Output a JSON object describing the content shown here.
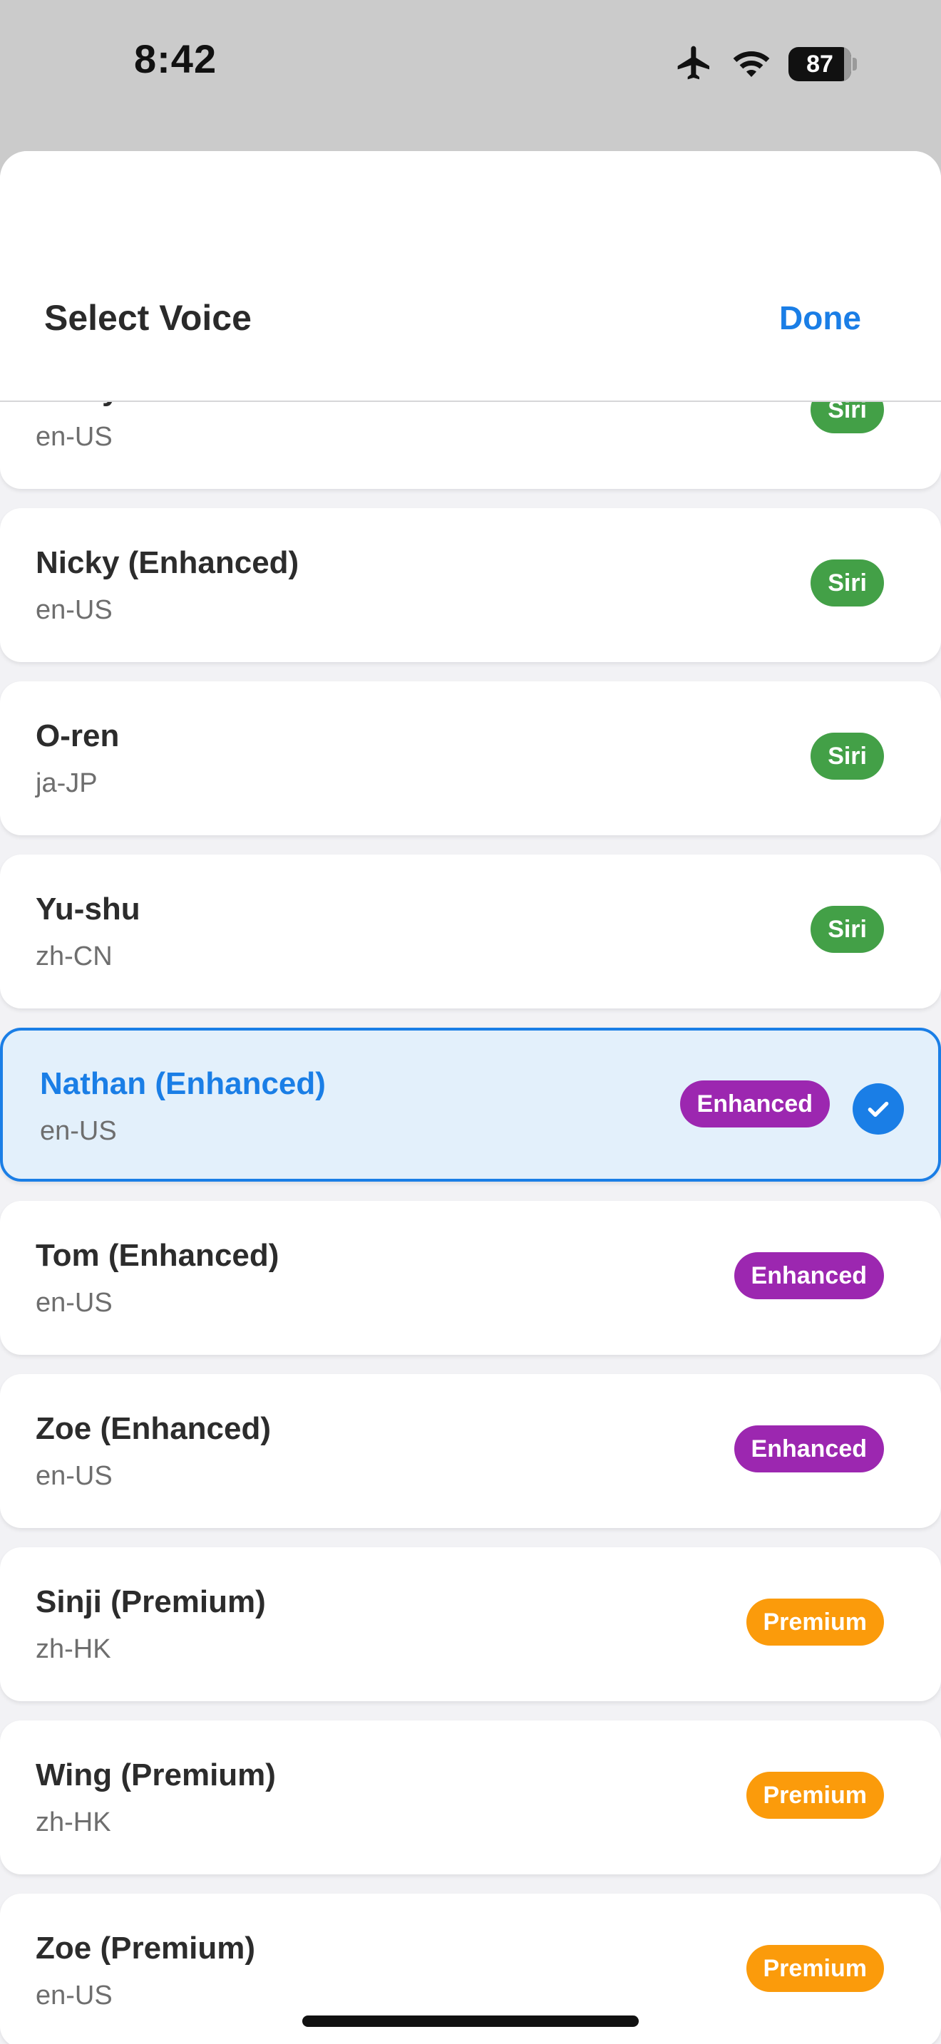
{
  "status_bar": {
    "time": "8:42",
    "battery": "87",
    "icons": [
      "airplane-icon",
      "wifi-icon",
      "battery-icon"
    ]
  },
  "header": {
    "title": "Select Voice",
    "done_label": "Done"
  },
  "colors": {
    "accent": "#1a7ee6",
    "siri": "#43a047",
    "enhanced": "#9c27b0",
    "premium": "#fb9b0b",
    "selected_bg": "#e3f0fb"
  },
  "voices": [
    {
      "name": "Nicky",
      "locale": "en-US",
      "badge": "Siri",
      "badge_type": "siri",
      "selected": false
    },
    {
      "name": "Nicky (Enhanced)",
      "locale": "en-US",
      "badge": "Siri",
      "badge_type": "siri",
      "selected": false
    },
    {
      "name": "O-ren",
      "locale": "ja-JP",
      "badge": "Siri",
      "badge_type": "siri",
      "selected": false
    },
    {
      "name": "Yu-shu",
      "locale": "zh-CN",
      "badge": "Siri",
      "badge_type": "siri",
      "selected": false
    },
    {
      "name": "Nathan (Enhanced)",
      "locale": "en-US",
      "badge": "Enhanced",
      "badge_type": "enhanced",
      "selected": true
    },
    {
      "name": "Tom (Enhanced)",
      "locale": "en-US",
      "badge": "Enhanced",
      "badge_type": "enhanced",
      "selected": false
    },
    {
      "name": "Zoe (Enhanced)",
      "locale": "en-US",
      "badge": "Enhanced",
      "badge_type": "enhanced",
      "selected": false
    },
    {
      "name": "Sinji (Premium)",
      "locale": "zh-HK",
      "badge": "Premium",
      "badge_type": "premium",
      "selected": false
    },
    {
      "name": "Wing (Premium)",
      "locale": "zh-HK",
      "badge": "Premium",
      "badge_type": "premium",
      "selected": false
    },
    {
      "name": "Zoe (Premium)",
      "locale": "en-US",
      "badge": "Premium",
      "badge_type": "premium",
      "selected": false
    }
  ]
}
